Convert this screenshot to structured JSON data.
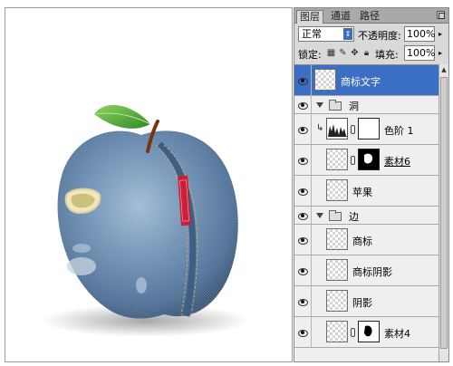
{
  "panel": {
    "tabs": [
      "图层",
      "通道",
      "路径"
    ],
    "blend_mode": "正常",
    "opacity_label": "不透明度:",
    "opacity_value": "100%",
    "lock_label": "锁定:",
    "fill_label": "填充:",
    "fill_value": "100%"
  },
  "layers": [
    {
      "name": "商标文字",
      "type": "layer",
      "selected": true
    },
    {
      "name": "洞",
      "type": "group",
      "expanded": true
    },
    {
      "name": "色阶 1",
      "type": "adjustment",
      "clipped": true
    },
    {
      "name": "素材6",
      "type": "layer_with_mask"
    },
    {
      "name": "苹果",
      "type": "layer"
    },
    {
      "name": "边",
      "type": "group",
      "expanded": true
    },
    {
      "name": "商标",
      "type": "layer"
    },
    {
      "name": "商标阴影",
      "type": "layer"
    },
    {
      "name": "阴影",
      "type": "layer"
    },
    {
      "name": "素材4",
      "type": "layer_with_mask"
    }
  ],
  "colors": {
    "selection": "#3b6fc4",
    "denim": "#5b7ea4",
    "leaf": "#49a33a",
    "label_red": "#c9203a"
  },
  "icons": {
    "visibility": "eye-icon",
    "folder": "folder-icon",
    "chain": "chain-link-icon",
    "adjustment": "levels-histogram-icon"
  }
}
